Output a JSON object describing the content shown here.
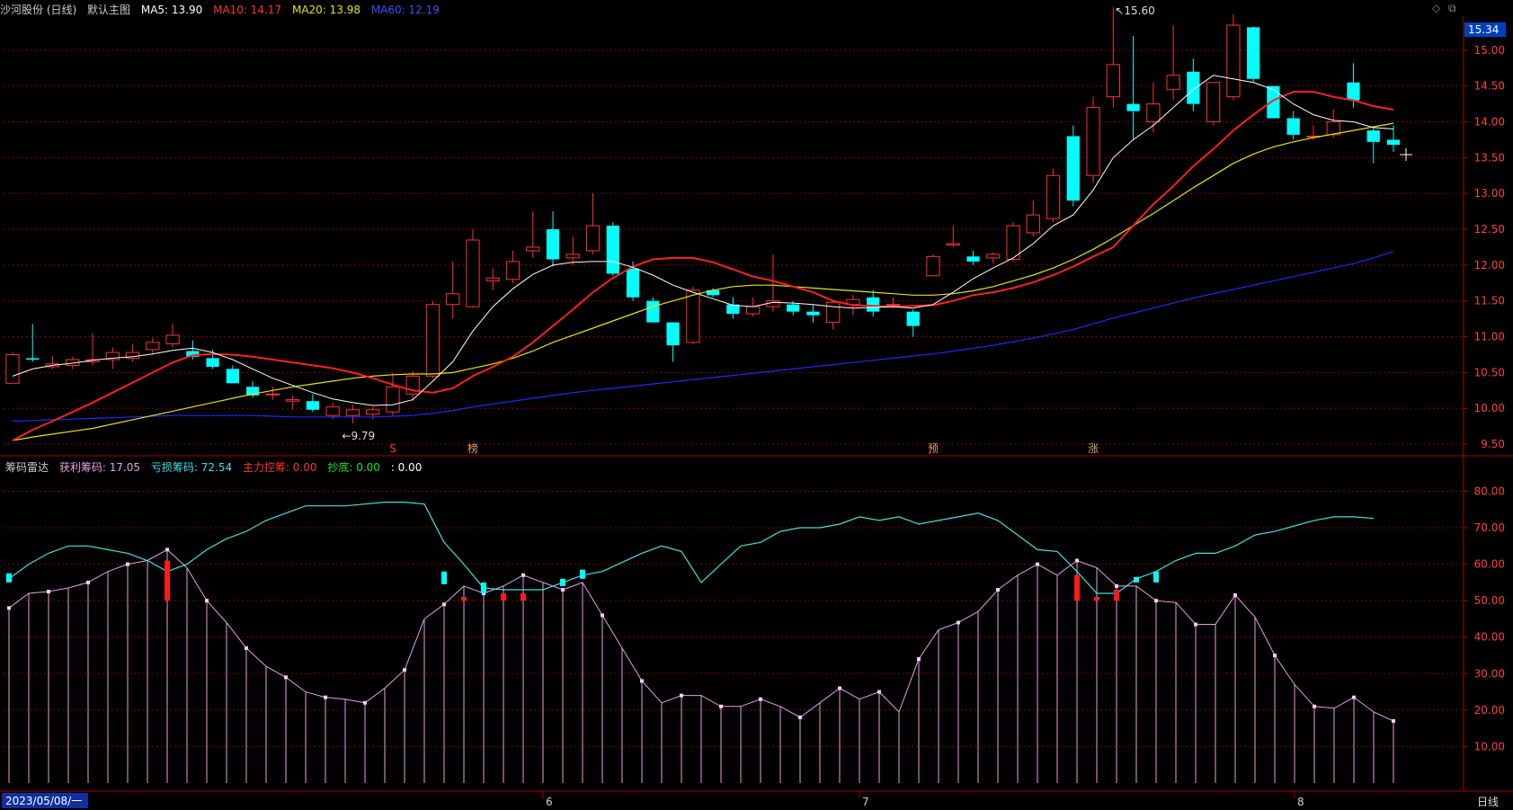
{
  "header": {
    "stock": "沙河股份 (日线)",
    "main_chart_label": "默认主图",
    "ma5": "MA5: 13.90",
    "ma10": "MA10: 14.17",
    "ma20": "MA20: 13.98",
    "ma60": "MA60: 12.19"
  },
  "sub_header": {
    "name": "筹码雷达",
    "profit": "获利筹码: 17.05",
    "loss": "亏损筹码: 72.54",
    "main_control": "主力控筹: 0.00",
    "bottom": "抄底: 0.00",
    "blank": ": 0.00"
  },
  "footer": {
    "date": "2023/05/08/一",
    "period": "日线",
    "month_labels": [
      "6",
      "7",
      "8"
    ]
  },
  "annotations": {
    "high": "15.60",
    "low": "9.79",
    "current_price": "15.34",
    "markers": [
      "S",
      "榜",
      "预",
      "涨"
    ]
  },
  "colors": {
    "bg": "#000000",
    "up": "#ff3232",
    "down": "#00ffff",
    "ma5": "#ffffff",
    "ma10": "#ff2020",
    "ma20": "#e6e600",
    "ma60": "#1e28ff",
    "profit": "#e6a0e6",
    "loss": "#40e0e0",
    "grid": "#8b0000"
  },
  "chart_data": [
    {
      "type": "candlestick",
      "title": "沙河股份 (日线)",
      "ylim": [
        9.4,
        15.4
      ],
      "yticks": [
        9.5,
        10.0,
        10.5,
        11.0,
        11.5,
        12.0,
        12.5,
        13.0,
        13.5,
        14.0,
        14.5,
        15.0
      ],
      "ohlc": [
        [
          10.35,
          10.78,
          10.35,
          10.75
        ],
        [
          10.7,
          11.18,
          10.65,
          10.68
        ],
        [
          10.58,
          10.73,
          10.55,
          10.62
        ],
        [
          10.6,
          10.72,
          10.55,
          10.68
        ],
        [
          10.65,
          11.05,
          10.6,
          10.68
        ],
        [
          10.68,
          10.85,
          10.55,
          10.78
        ],
        [
          10.7,
          10.9,
          10.65,
          10.78
        ],
        [
          10.82,
          10.98,
          10.75,
          10.92
        ],
        [
          10.9,
          11.18,
          10.85,
          11.02
        ],
        [
          10.8,
          10.95,
          10.68,
          10.72
        ],
        [
          10.7,
          10.82,
          10.55,
          10.58
        ],
        [
          10.55,
          10.6,
          10.35,
          10.35
        ],
        [
          10.3,
          10.38,
          10.15,
          10.18
        ],
        [
          10.2,
          10.3,
          10.12,
          10.2
        ],
        [
          10.1,
          10.18,
          9.98,
          10.12
        ],
        [
          10.1,
          10.2,
          9.95,
          9.98
        ],
        [
          9.9,
          10.08,
          9.85,
          10.02
        ],
        [
          9.9,
          10.05,
          9.79,
          9.98
        ],
        [
          9.92,
          10.02,
          9.85,
          9.98
        ],
        [
          9.95,
          10.5,
          9.9,
          10.3
        ],
        [
          10.2,
          10.52,
          10.1,
          10.45
        ],
        [
          10.45,
          11.5,
          10.42,
          11.45
        ],
        [
          11.45,
          12.05,
          11.25,
          11.6
        ],
        [
          11.42,
          12.5,
          11.4,
          12.35
        ],
        [
          11.78,
          11.95,
          11.65,
          11.82
        ],
        [
          11.8,
          12.2,
          11.75,
          12.05
        ],
        [
          12.2,
          12.75,
          12.1,
          12.25
        ],
        [
          12.5,
          12.75,
          11.98,
          12.08
        ],
        [
          12.1,
          12.4,
          12.0,
          12.15
        ],
        [
          12.2,
          13.0,
          12.15,
          12.55
        ],
        [
          12.55,
          12.6,
          11.85,
          11.88
        ],
        [
          11.95,
          12.05,
          11.5,
          11.55
        ],
        [
          11.5,
          11.55,
          11.2,
          11.2
        ],
        [
          11.2,
          11.2,
          10.65,
          10.88
        ],
        [
          10.92,
          11.7,
          10.9,
          11.65
        ],
        [
          11.65,
          11.68,
          11.55,
          11.58
        ],
        [
          11.45,
          11.55,
          11.25,
          11.32
        ],
        [
          11.32,
          11.55,
          11.28,
          11.42
        ],
        [
          11.42,
          12.15,
          11.35,
          11.5
        ],
        [
          11.45,
          11.5,
          11.3,
          11.35
        ],
        [
          11.35,
          11.45,
          11.2,
          11.3
        ],
        [
          11.2,
          11.5,
          11.1,
          11.48
        ],
        [
          11.45,
          11.58,
          11.3,
          11.52
        ],
        [
          11.55,
          11.65,
          11.28,
          11.35
        ],
        [
          11.45,
          11.55,
          11.4,
          11.45
        ],
        [
          11.35,
          11.38,
          11.0,
          11.15
        ],
        [
          11.85,
          12.15,
          11.85,
          12.12
        ],
        [
          12.28,
          12.55,
          12.25,
          12.3
        ],
        [
          12.12,
          12.2,
          12.0,
          12.05
        ],
        [
          12.1,
          12.18,
          12.02,
          12.15
        ],
        [
          12.08,
          12.6,
          12.05,
          12.55
        ],
        [
          12.45,
          12.9,
          12.4,
          12.7
        ],
        [
          12.65,
          13.35,
          12.6,
          13.25
        ],
        [
          13.8,
          13.95,
          12.82,
          12.9
        ],
        [
          13.25,
          14.35,
          13.15,
          14.2
        ],
        [
          14.35,
          15.6,
          14.2,
          14.8
        ],
        [
          14.25,
          15.2,
          13.75,
          14.15
        ],
        [
          14.0,
          14.55,
          13.85,
          14.25
        ],
        [
          14.45,
          15.35,
          14.3,
          14.65
        ],
        [
          14.7,
          14.88,
          14.15,
          14.25
        ],
        [
          14.0,
          14.55,
          13.95,
          14.55
        ],
        [
          14.35,
          15.5,
          14.3,
          15.35
        ],
        [
          15.32,
          15.33,
          14.55,
          14.6
        ],
        [
          14.5,
          14.5,
          14.05,
          14.05
        ],
        [
          14.05,
          14.15,
          13.75,
          13.82
        ],
        [
          13.8,
          13.95,
          13.75,
          13.8
        ],
        [
          13.82,
          14.18,
          13.78,
          14.0
        ],
        [
          14.55,
          14.82,
          14.2,
          14.3
        ],
        [
          13.88,
          13.92,
          13.42,
          13.72
        ],
        [
          13.75,
          13.95,
          13.58,
          13.68
        ]
      ],
      "ma5": [
        10.45,
        10.55,
        10.6,
        10.63,
        10.67,
        10.7,
        10.72,
        10.76,
        10.81,
        10.84,
        10.78,
        10.68,
        10.55,
        10.42,
        10.32,
        10.22,
        10.13,
        10.08,
        10.04,
        10.05,
        10.12,
        10.38,
        10.65,
        11.08,
        11.42,
        11.67,
        11.87,
        12.0,
        12.04,
        12.05,
        12.05,
        11.97,
        11.86,
        11.72,
        11.62,
        11.53,
        11.44,
        11.42,
        11.48,
        11.47,
        11.45,
        11.42,
        11.4,
        11.41,
        11.42,
        11.4,
        11.45,
        11.62,
        11.81,
        11.96,
        12.1,
        12.3,
        12.55,
        12.7,
        13.05,
        13.5,
        13.75,
        13.95,
        14.2,
        14.45,
        14.65,
        14.6,
        14.55,
        14.45,
        14.25,
        14.1,
        14.02,
        14.0,
        13.92,
        13.9
      ],
      "ma10": [
        9.55,
        9.7,
        9.82,
        9.95,
        10.08,
        10.22,
        10.36,
        10.5,
        10.64,
        10.74,
        10.76,
        10.75,
        10.72,
        10.68,
        10.64,
        10.6,
        10.56,
        10.5,
        10.42,
        10.33,
        10.25,
        10.22,
        10.28,
        10.45,
        10.58,
        10.72,
        10.92,
        11.15,
        11.38,
        11.62,
        11.82,
        11.98,
        12.08,
        12.1,
        12.1,
        12.04,
        11.94,
        11.84,
        11.78,
        11.7,
        11.62,
        11.5,
        11.44,
        11.43,
        11.42,
        11.43,
        11.44,
        11.5,
        11.58,
        11.62,
        11.68,
        11.76,
        11.86,
        11.98,
        12.12,
        12.25,
        12.55,
        12.85,
        13.1,
        13.38,
        13.62,
        13.88,
        14.1,
        14.3,
        14.42,
        14.42,
        14.35,
        14.3,
        14.22,
        14.17
      ],
      "ma20": [
        9.55,
        9.6,
        9.64,
        9.68,
        9.72,
        9.78,
        9.84,
        9.9,
        9.96,
        10.02,
        10.08,
        10.14,
        10.2,
        10.25,
        10.3,
        10.34,
        10.38,
        10.42,
        10.45,
        10.47,
        10.48,
        10.48,
        10.5,
        10.56,
        10.62,
        10.7,
        10.8,
        10.92,
        11.02,
        11.12,
        11.22,
        11.32,
        11.42,
        11.5,
        11.58,
        11.65,
        11.7,
        11.72,
        11.72,
        11.7,
        11.68,
        11.66,
        11.64,
        11.62,
        11.6,
        11.58,
        11.58,
        11.6,
        11.64,
        11.7,
        11.78,
        11.86,
        11.96,
        12.08,
        12.22,
        12.38,
        12.55,
        12.72,
        12.9,
        13.08,
        13.25,
        13.42,
        13.55,
        13.65,
        13.72,
        13.78,
        13.83,
        13.88,
        13.93,
        13.98
      ],
      "ma60": [
        9.82,
        9.83,
        9.84,
        9.85,
        9.86,
        9.87,
        9.88,
        9.89,
        9.9,
        9.9,
        9.9,
        9.9,
        9.9,
        9.89,
        9.88,
        9.88,
        9.88,
        9.88,
        9.88,
        9.89,
        9.9,
        9.93,
        9.97,
        10.02,
        10.06,
        10.1,
        10.14,
        10.18,
        10.22,
        10.25,
        10.28,
        10.31,
        10.34,
        10.37,
        10.4,
        10.43,
        10.46,
        10.49,
        10.52,
        10.55,
        10.58,
        10.61,
        10.64,
        10.67,
        10.7,
        10.73,
        10.76,
        10.8,
        10.84,
        10.88,
        10.93,
        10.98,
        11.04,
        11.1,
        11.18,
        11.26,
        11.33,
        11.4,
        11.47,
        11.54,
        11.6,
        11.66,
        11.72,
        11.78,
        11.84,
        11.9,
        11.96,
        12.02,
        12.1,
        12.19
      ]
    },
    {
      "type": "line",
      "title": "筹码雷达",
      "ylim": [
        0,
        88
      ],
      "yticks": [
        10,
        20,
        30,
        40,
        50,
        60,
        70,
        80
      ],
      "series": [
        {
          "name": "获利筹码",
          "values": [
            48,
            52,
            52.5,
            53.5,
            55,
            58,
            60,
            61,
            64,
            59,
            50,
            44,
            37,
            32,
            29,
            25,
            23.5,
            23,
            22,
            26,
            31,
            45,
            49,
            54,
            52,
            54,
            57,
            55,
            53,
            55,
            46,
            37,
            28,
            22,
            24,
            24,
            21,
            21,
            23,
            21,
            18,
            22,
            26,
            23,
            25,
            19.5,
            34,
            42,
            44,
            47,
            53,
            57,
            60,
            57,
            61,
            59,
            54,
            54,
            50,
            49.5,
            43.5,
            43.5,
            51.5,
            45.5,
            35,
            27,
            21,
            20.5,
            23.5,
            19.5,
            17
          ]
        },
        {
          "name": "亏损筹码",
          "values": [
            56,
            60,
            63,
            65,
            65,
            64,
            63,
            61,
            58,
            60,
            64,
            67,
            69,
            72,
            74,
            76,
            76,
            76,
            76.5,
            77,
            77,
            76.5,
            66,
            60,
            53.5,
            53,
            53,
            53,
            55,
            57,
            58,
            60.5,
            63,
            65,
            63.5,
            55,
            60,
            65,
            66,
            69,
            70,
            70,
            71,
            73,
            72,
            73,
            71,
            72,
            73,
            74,
            72,
            68,
            64,
            63.5,
            58,
            52,
            52,
            56,
            58,
            61,
            63,
            63,
            65,
            68,
            69,
            70.5,
            72,
            73,
            73,
            72.54
          ]
        }
      ],
      "profit_markers": [
        0,
        22,
        24,
        26,
        28,
        54,
        57
      ],
      "cyan_bars": [
        {
          "index": 0,
          "from": 55,
          "to": 57.5
        },
        {
          "index": 22,
          "from": 54.5,
          "to": 58
        },
        {
          "index": 24,
          "from": 52,
          "to": 55
        },
        {
          "index": 28,
          "from": 54,
          "to": 56
        },
        {
          "index": 29,
          "from": 56,
          "to": 58.5
        },
        {
          "index": 57,
          "from": 55,
          "to": 56.5
        },
        {
          "index": 58,
          "from": 55,
          "to": 58
        }
      ],
      "red_bars": [
        {
          "index": 8,
          "from": 50,
          "to": 61
        },
        {
          "index": 23,
          "from": 50,
          "to": 51
        },
        {
          "index": 25,
          "from": 50,
          "to": 52
        },
        {
          "index": 26,
          "from": 50,
          "to": 52
        },
        {
          "index": 54,
          "from": 50,
          "to": 57
        },
        {
          "index": 55,
          "from": 50,
          "to": 51
        },
        {
          "index": 56,
          "from": 50,
          "to": 53
        }
      ]
    }
  ]
}
